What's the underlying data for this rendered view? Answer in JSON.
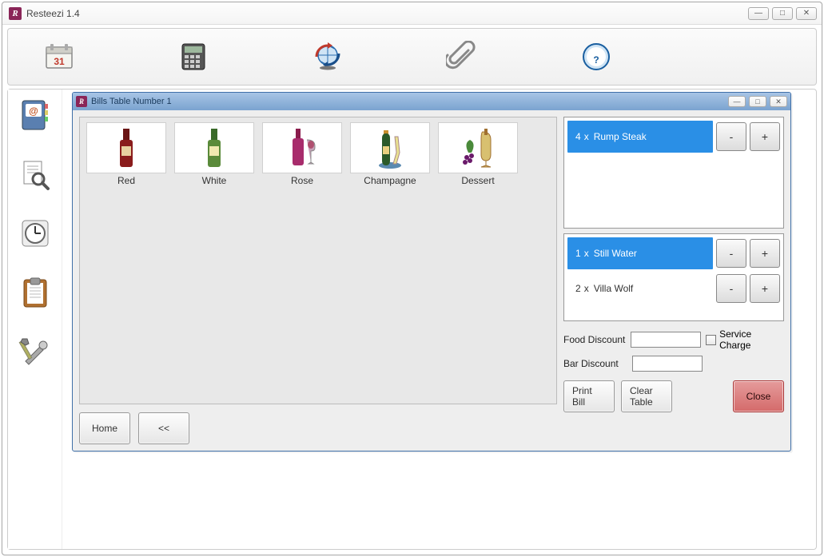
{
  "app": {
    "title": "Resteezi 1.4"
  },
  "childWindow": {
    "title": "Bills Table Number 1"
  },
  "products": [
    {
      "name": "Red"
    },
    {
      "name": "White"
    },
    {
      "name": "Rose"
    },
    {
      "name": "Champagne"
    },
    {
      "name": "Dessert"
    }
  ],
  "nav": {
    "home": "Home",
    "back": "<<"
  },
  "orders_upper": [
    {
      "qty": 4,
      "name": "Rump Steak",
      "selected": true
    }
  ],
  "orders_lower": [
    {
      "qty": 1,
      "name": "Still Water",
      "selected": true
    },
    {
      "qty": 2,
      "name": "Villa Wolf",
      "selected": false
    }
  ],
  "discount": {
    "food_label": "Food Discount",
    "food_value": "",
    "bar_label": "Bar Discount",
    "bar_value": "",
    "service_label": "Service Charge",
    "service_checked": false
  },
  "actions": {
    "print": "Print Bill",
    "clear": "Clear Table",
    "close": "Close"
  },
  "glyphs": {
    "minus": "-",
    "plus": "+",
    "times": "x"
  }
}
